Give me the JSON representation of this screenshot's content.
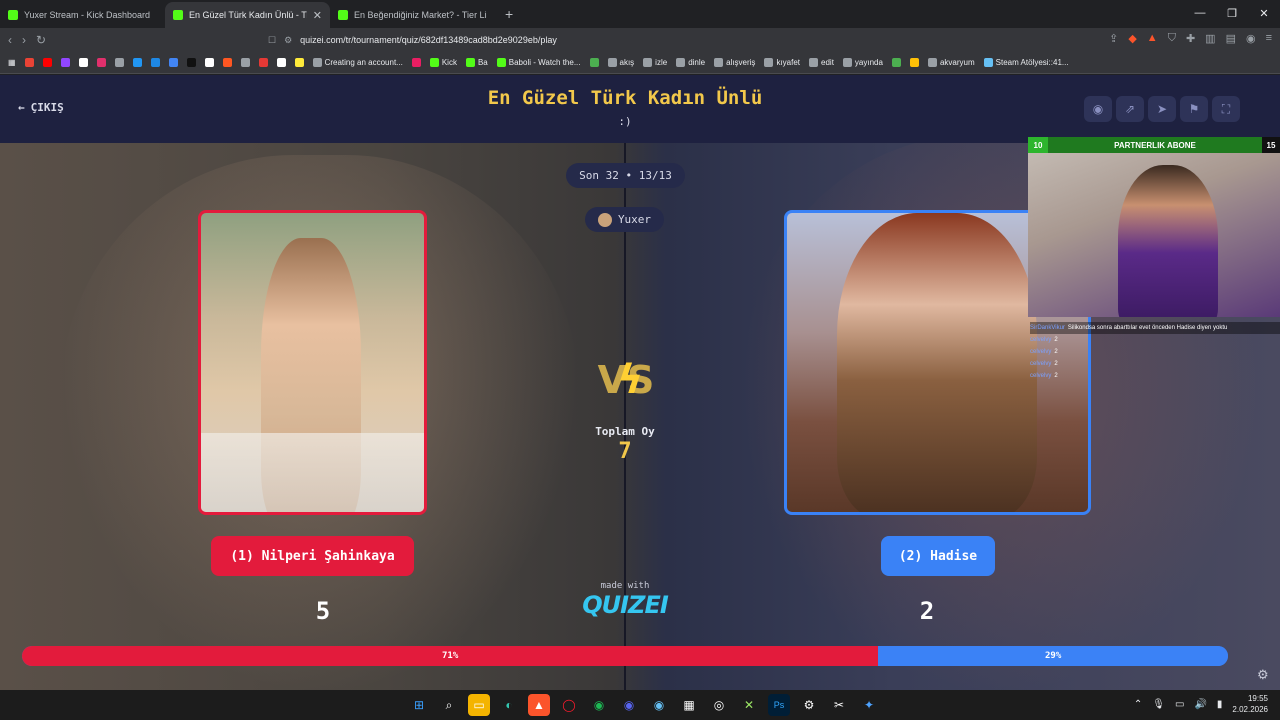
{
  "browser": {
    "tabs": [
      {
        "title": "Yuxer Stream - Kick Dashboard",
        "active": false,
        "favicon_color": "#53fc18"
      },
      {
        "title": "En Güzel Türk Kadın Ünlü - Tier L",
        "active": true,
        "favicon_color": "#53fc18"
      },
      {
        "title": "En Beğendiğiniz Market? - Tier List",
        "active": false,
        "favicon_color": "#53fc18"
      }
    ],
    "new_tab": "+",
    "url": "quizei.com/tr/tournament/quiz/682df13489cad8bd2e9029eb/play",
    "bookmarks": [
      {
        "label": "",
        "color": "#ea4335"
      },
      {
        "label": "",
        "color": "#ff0000"
      },
      {
        "label": "",
        "color": "#9146ff"
      },
      {
        "label": "",
        "color": "#ffffff"
      },
      {
        "label": "",
        "color": "#e1306c"
      },
      {
        "label": "",
        "color": "#9aa0a6"
      },
      {
        "label": "",
        "color": "#2196f3"
      },
      {
        "label": "",
        "color": "#1e88e5"
      },
      {
        "label": "",
        "color": "#4285f4"
      },
      {
        "label": "",
        "color": "#111111"
      },
      {
        "label": "",
        "color": "#ffffff"
      },
      {
        "label": "",
        "color": "#ff5722"
      },
      {
        "label": "",
        "color": "#9aa0a6"
      },
      {
        "label": "",
        "color": "#e53935"
      },
      {
        "label": "",
        "color": "#ffffff"
      },
      {
        "label": "",
        "color": "#ffeb3b"
      },
      {
        "label": "Creating an account...",
        "color": "#9aa0a6"
      },
      {
        "label": "",
        "color": "#e91e63"
      },
      {
        "label": "Kick",
        "color": "#53fc18"
      },
      {
        "label": "Ba",
        "color": "#53fc18"
      },
      {
        "label": "Baboli - Watch the...",
        "color": "#53fc18"
      },
      {
        "label": "",
        "color": "#4caf50"
      },
      {
        "label": "akış",
        "color": "#9aa0a6"
      },
      {
        "label": "izle",
        "color": "#9aa0a6"
      },
      {
        "label": "dinle",
        "color": "#9aa0a6"
      },
      {
        "label": "alışveriş",
        "color": "#9aa0a6"
      },
      {
        "label": "kıyafet",
        "color": "#9aa0a6"
      },
      {
        "label": "edit",
        "color": "#9aa0a6"
      },
      {
        "label": "yayında",
        "color": "#9aa0a6"
      },
      {
        "label": "",
        "color": "#4caf50"
      },
      {
        "label": "",
        "color": "#ffc107"
      },
      {
        "label": "akvaryum",
        "color": "#9aa0a6"
      },
      {
        "label": "Steam Atölyesi::41...",
        "color": "#66c0f4"
      }
    ]
  },
  "page": {
    "exit_label": "ÇIKIŞ",
    "title": "En Güzel Türk Kadın Ünlü",
    "subtitle": ":)",
    "round_label": "Son 32 • 13/13",
    "username": "Yuxer",
    "vs_label": "VS",
    "total_label": "Toplam Oy",
    "total_value": "7",
    "made_with": "made with",
    "logo_text": "QUIZEI",
    "left": {
      "choice_label": "(1) Nilperi Şahinkaya",
      "votes": "5",
      "percent_label": "71%",
      "share": 71,
      "color": "#e31b3c"
    },
    "right": {
      "choice_label": "(2) Hadise",
      "votes": "2",
      "percent_label": "29%",
      "share": 29,
      "color": "#3b82f6"
    }
  },
  "stream_overlay": {
    "left_count": "10",
    "banner": "PARTNERLIK ABONE",
    "right_count": "15",
    "chat": [
      {
        "name": "SirDankVikur",
        "text": "Silikondsa sonra abarttılar evet önceden Hadise diyen yoktu"
      },
      {
        "name": "celvelvy",
        "text": "2"
      },
      {
        "name": "celvelvy",
        "text": "2"
      },
      {
        "name": "celvelvy",
        "text": "2"
      },
      {
        "name": "celvelvy",
        "text": "2"
      }
    ]
  },
  "taskbar": {
    "time": "19:55",
    "date": "2.02.2026"
  }
}
